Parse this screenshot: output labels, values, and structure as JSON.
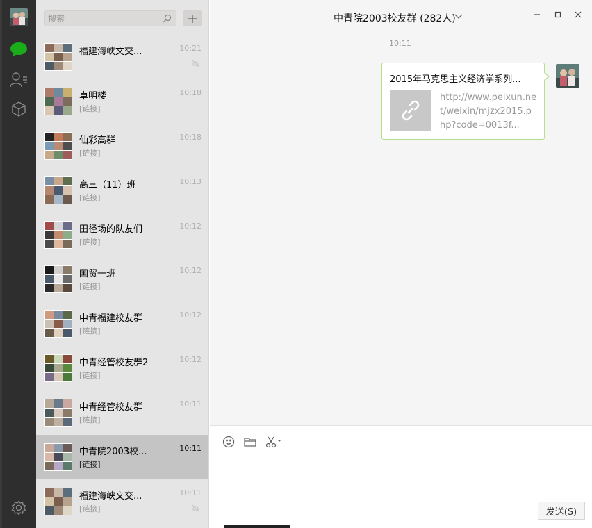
{
  "search": {
    "placeholder": "搜索"
  },
  "nav": {
    "icons": [
      "avatar",
      "chat-icon",
      "contacts-icon",
      "favorites-icon",
      "settings-icon"
    ],
    "accent": "#1aad19"
  },
  "chats": [
    {
      "title": "福建海峡文交...",
      "sub": "",
      "time": "10:21",
      "muted": true
    },
    {
      "title": "卓明楼",
      "sub": "[链接]",
      "time": "10:18"
    },
    {
      "title": "仙彩高群",
      "sub": "[链接]",
      "time": "10:18"
    },
    {
      "title": "高三（11）班",
      "sub": "[链接]",
      "time": "10:13"
    },
    {
      "title": "田径场的队友们",
      "sub": "[链接]",
      "time": "10:12"
    },
    {
      "title": "国贸一班",
      "sub": "[链接]",
      "time": "10:12"
    },
    {
      "title": "中青福建校友群",
      "sub": "[链接]",
      "time": "10:12"
    },
    {
      "title": "中青经管校友群2",
      "sub": "[链接]",
      "time": "10:12"
    },
    {
      "title": "中青经管校友群",
      "sub": "[链接]",
      "time": "10:11"
    },
    {
      "title": "中青院2003校...",
      "sub": "[链接]",
      "time": "10:11",
      "active": true
    },
    {
      "title": "福建海峡文交...",
      "sub": "[链接]",
      "time": "10:11",
      "muted": true
    }
  ],
  "chat": {
    "title": "中青院2003校友群 (282人)",
    "timestamp": "10:11",
    "message": {
      "title": "2015年马克思主义经济学系列...",
      "desc": "http://www.peixun.net/weixin/mjzx2015.php?code=0013f..."
    },
    "send_label": "发送(S)"
  }
}
